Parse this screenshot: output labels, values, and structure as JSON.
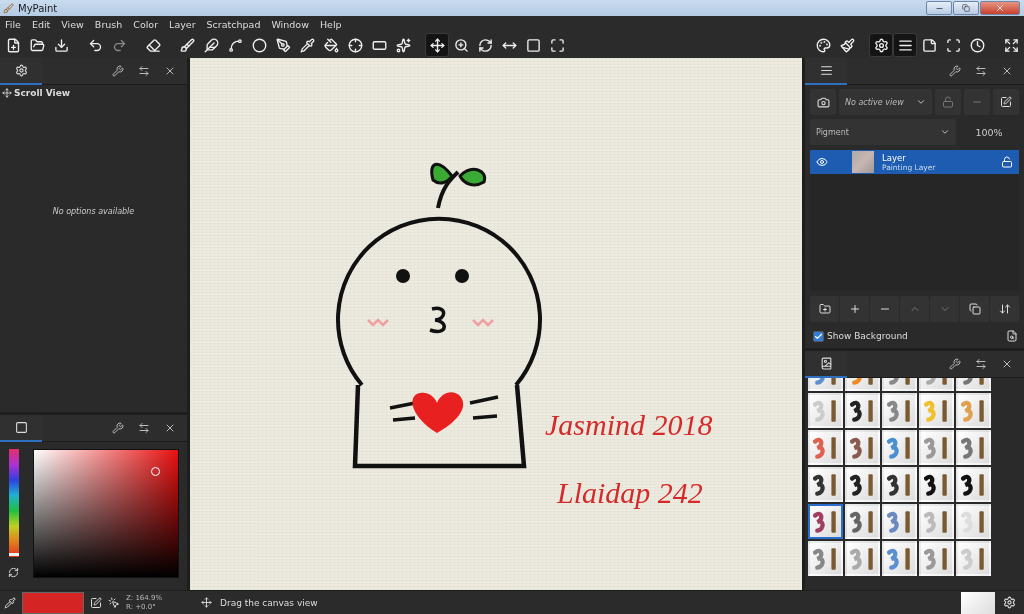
{
  "window": {
    "title": "MyPaint"
  },
  "menu": [
    "File",
    "Edit",
    "View",
    "Brush",
    "Color",
    "Layer",
    "Scratchpad",
    "Window",
    "Help"
  ],
  "toolbar": [
    {
      "kind": "new",
      "selected": false
    },
    {
      "kind": "open",
      "selected": false
    },
    {
      "kind": "save",
      "selected": false
    },
    {
      "kind": "gap"
    },
    {
      "kind": "undo",
      "selected": false
    },
    {
      "kind": "redo",
      "selected": false
    },
    {
      "kind": "gap"
    },
    {
      "kind": "eraser",
      "selected": false
    },
    {
      "kind": "gap"
    },
    {
      "kind": "brush",
      "selected": false
    },
    {
      "kind": "inking",
      "selected": false
    },
    {
      "kind": "lasso",
      "selected": false
    },
    {
      "kind": "ellipse",
      "selected": false
    },
    {
      "kind": "pen",
      "selected": false
    },
    {
      "kind": "picker",
      "selected": false
    },
    {
      "kind": "fill",
      "selected": false
    },
    {
      "kind": "layer-move",
      "selected": false
    },
    {
      "kind": "frame",
      "selected": false
    },
    {
      "kind": "symmetry",
      "selected": false
    },
    {
      "kind": "gap"
    },
    {
      "kind": "pan",
      "selected": true
    },
    {
      "kind": "zoom",
      "selected": false
    },
    {
      "kind": "rotate",
      "selected": false
    },
    {
      "kind": "fit-width",
      "selected": false
    },
    {
      "kind": "actual",
      "selected": false
    },
    {
      "kind": "fit",
      "selected": false
    },
    {
      "kind": "spring"
    },
    {
      "kind": "colors",
      "selected": false
    },
    {
      "kind": "brushes",
      "selected": false
    },
    {
      "kind": "gap"
    },
    {
      "kind": "options",
      "selected": true
    },
    {
      "kind": "layers",
      "selected": true
    },
    {
      "kind": "scratchpad",
      "selected": false
    },
    {
      "kind": "fullscreen",
      "selected": false
    },
    {
      "kind": "history",
      "selected": false
    },
    {
      "kind": "gap"
    },
    {
      "kind": "expand",
      "selected": false
    }
  ],
  "tool_options": {
    "title": "Scroll View",
    "message": "No options available"
  },
  "color_panel": {
    "hue": {
      "level": 0.02
    }
  },
  "layers_panel": {
    "view_placeholder": "No active view",
    "mode": "Pigment",
    "opacity": "100%",
    "layers": [
      {
        "name": "Layer",
        "type": "Painting Layer",
        "selected": true,
        "visible": true,
        "locked": false
      }
    ],
    "show_background": {
      "label": "Show Background",
      "checked": true
    }
  },
  "brushes": [
    {
      "selected": false
    },
    {
      "selected": false
    },
    {
      "selected": false
    },
    {
      "selected": false
    },
    {
      "selected": false
    },
    {
      "selected": false
    },
    {
      "selected": false
    },
    {
      "selected": false
    },
    {
      "selected": false
    },
    {
      "selected": false
    },
    {
      "selected": false
    },
    {
      "selected": false
    },
    {
      "selected": false
    },
    {
      "selected": false
    },
    {
      "selected": false
    },
    {
      "selected": false
    },
    {
      "selected": false
    },
    {
      "selected": false
    },
    {
      "selected": false
    },
    {
      "selected": false
    },
    {
      "selected": true
    },
    {
      "selected": false
    },
    {
      "selected": false
    },
    {
      "selected": false
    },
    {
      "selected": false
    },
    {
      "selected": false
    },
    {
      "selected": false
    },
    {
      "selected": false
    },
    {
      "selected": false
    },
    {
      "selected": false
    }
  ],
  "canvas": {
    "notes": [
      "Jasmind 2018",
      "Llaidap 242"
    ]
  },
  "status_bar": {
    "zoom": "Z: 164.9%",
    "rotation": "R: +0.0°",
    "message": "Drag the canvas view"
  }
}
